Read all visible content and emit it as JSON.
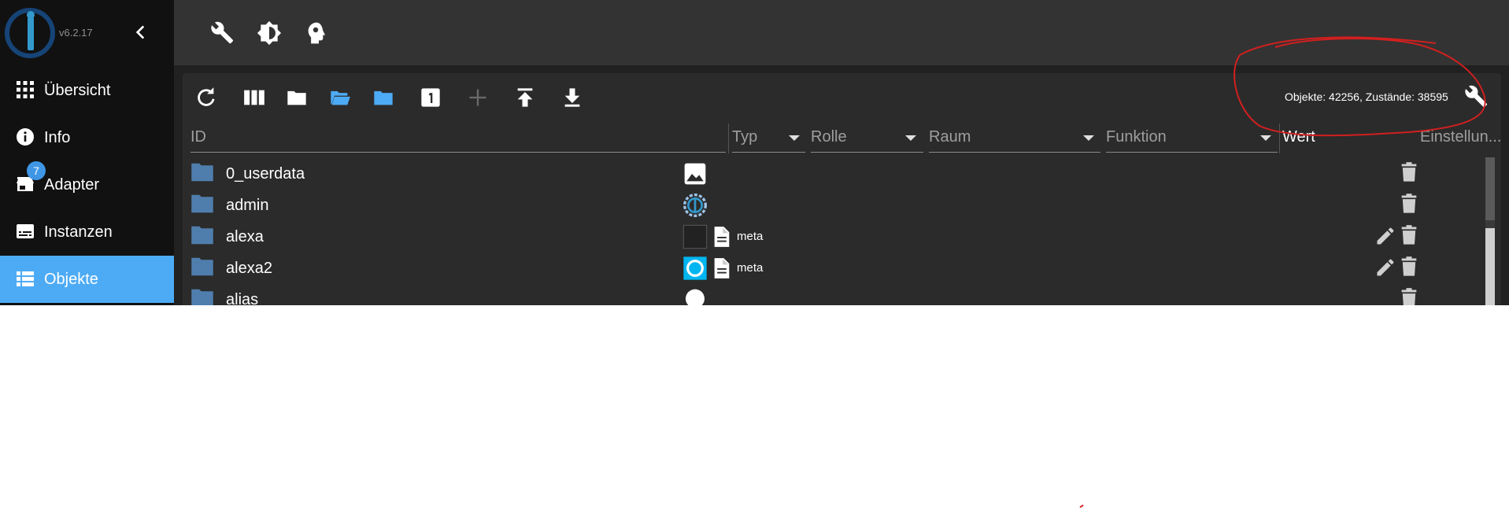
{
  "app": {
    "version": "v6.2.17"
  },
  "sidebar": {
    "items": [
      {
        "label": "Übersicht",
        "icon": "grid-icon"
      },
      {
        "label": "Info",
        "icon": "info-icon"
      },
      {
        "label": "Adapter",
        "icon": "store-icon",
        "badge": "7"
      },
      {
        "label": "Instanzen",
        "icon": "instances-icon"
      },
      {
        "label": "Objekte",
        "icon": "list-icon",
        "active": true
      }
    ]
  },
  "topbar": {
    "icons": [
      "wrench-icon",
      "brightness-icon",
      "expert-mode-icon"
    ]
  },
  "toolbar": {
    "icons": [
      "refresh-icon",
      "columns-icon",
      "folder-closed-icon",
      "folder-open-icon",
      "folder-icon",
      "number-one-icon",
      "add-icon",
      "upload-icon",
      "download-icon"
    ],
    "stats": "Objekte: 42256, Zustände: 38595"
  },
  "columns": {
    "id": "ID",
    "typ": "Typ",
    "rolle": "Rolle",
    "raum": "Raum",
    "funktion": "Funktion",
    "wert": "Wert",
    "einstellungen": "Einstellun..."
  },
  "rows": [
    {
      "name": "0_userdata",
      "icon": "image-icon",
      "meta": ""
    },
    {
      "name": "admin",
      "icon": "iobroker-admin-icon",
      "meta": ""
    },
    {
      "name": "alexa",
      "icon": "blank-square-icon",
      "meta": "meta"
    },
    {
      "name": "alexa2",
      "icon": "alexa-ring-icon",
      "meta": "meta"
    },
    {
      "name": "alias",
      "icon": "bulb-icon",
      "meta": ""
    }
  ],
  "colors": {
    "sidebar_bg": "#111111",
    "active_nav": "#4dabf5",
    "topbar_bg": "#333333",
    "panel_bg": "#2b2b2b",
    "folder": "#4f7ead",
    "accent_blue": "#4dabf5",
    "annotation_red": "#d21f1f"
  }
}
